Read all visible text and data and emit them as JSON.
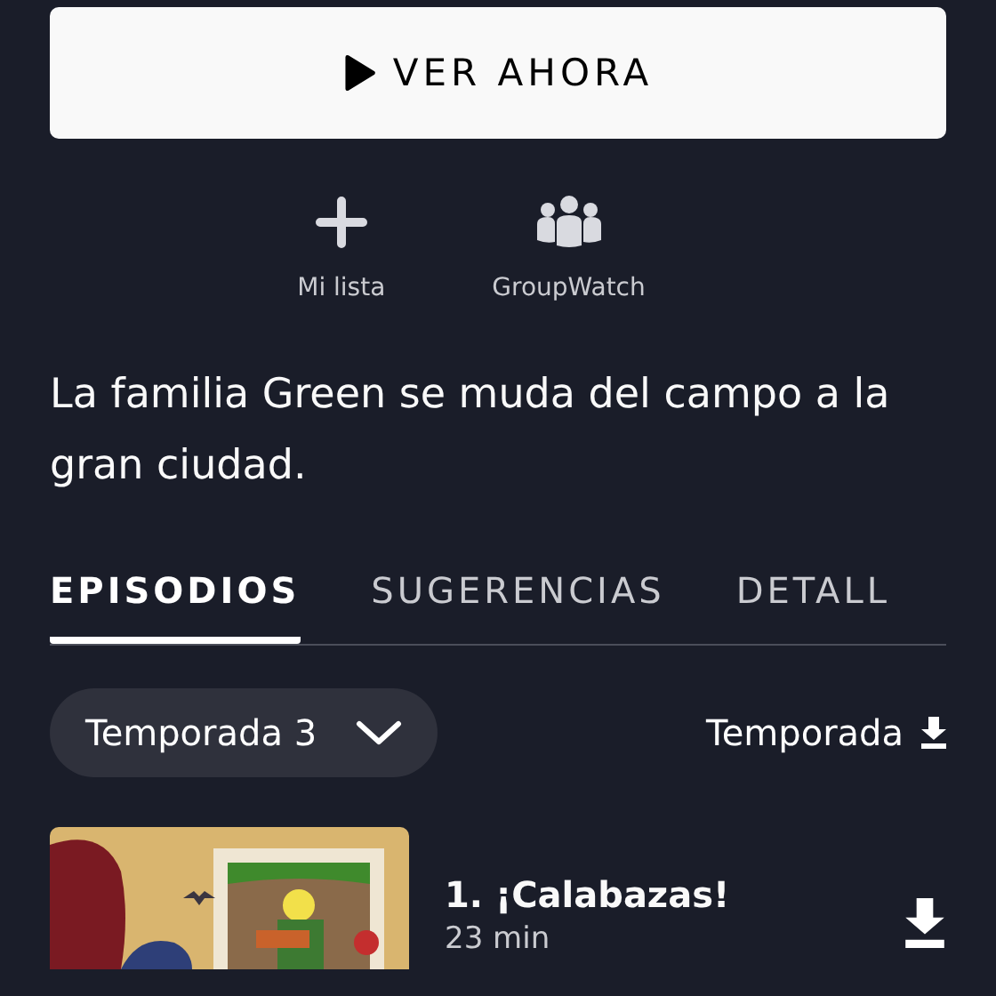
{
  "play_button": {
    "label": "VER AHORA"
  },
  "actions": [
    {
      "kind": "add",
      "label": "Mi lista"
    },
    {
      "kind": "group",
      "label": "GroupWatch"
    }
  ],
  "description": "La familia Green se muda del campo a la gran ciudad.",
  "tabs": [
    {
      "label": "EPISODIOS",
      "selected": true
    },
    {
      "label": "SUGERENCIAS",
      "selected": false
    },
    {
      "label": "DETALL",
      "selected": false
    }
  ],
  "season_selector": {
    "value": "Temporada 3"
  },
  "season_download": {
    "label": "Temporada"
  },
  "episodes": [
    {
      "kind": "picture",
      "title": "1. ¡Calabazas!",
      "duration": "23 min"
    }
  ]
}
